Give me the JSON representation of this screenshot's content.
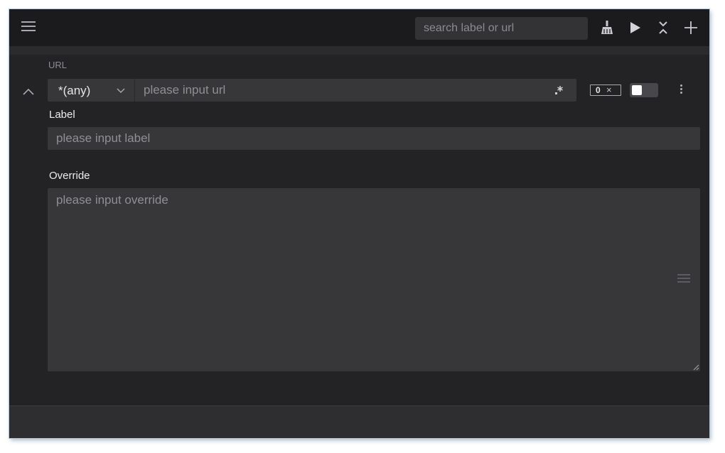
{
  "topbar": {
    "search_placeholder": "search label or url",
    "icons": [
      "menu-icon",
      "broom-icon",
      "play-icon",
      "collapse-all-icon",
      "plus-icon"
    ]
  },
  "rule": {
    "url_section_label": "URL",
    "match_mode": "*(any)",
    "url_placeholder": "please input url",
    "hit_count": "0",
    "clear_symbol": "×",
    "enabled": false,
    "label_heading": "Label",
    "label_placeholder": "please input label",
    "override_heading": "Override",
    "override_placeholder": "please input override"
  },
  "colors": {
    "background": "#232326",
    "topbar": "#1b1b1e",
    "field": "#37373a",
    "text": "#ececef",
    "placeholder": "#8f8f94"
  }
}
